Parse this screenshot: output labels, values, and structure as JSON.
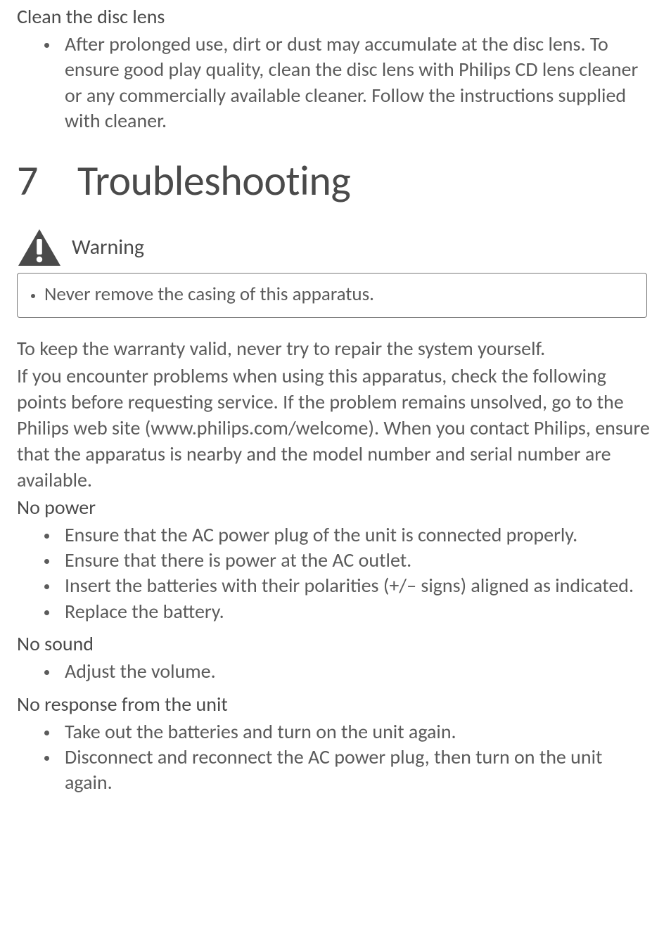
{
  "intro": {
    "heading": "Clean the disc lens",
    "bullets": [
      "After prolonged use, dirt or dust may accumulate at the disc lens. To ensure good play quality, clean the disc lens with Philips CD lens cleaner or any commercially available cleaner. Follow the instructions supplied with cleaner."
    ]
  },
  "chapter": {
    "number": "7",
    "title": "Troubleshooting"
  },
  "warning": {
    "label": "Warning",
    "items": [
      "Never remove the casing of this apparatus."
    ]
  },
  "body_paragraphs": [
    "To keep the warranty valid, never try to repair the system yourself.",
    "If you encounter problems when using this apparatus, check the following points before requesting service. If the problem remains unsolved, go to the Philips web site (www.philips.com/welcome). When you contact Philips, ensure that the apparatus is nearby and the model number and serial number are available."
  ],
  "sections": [
    {
      "heading": "No power",
      "bullets": [
        "Ensure that the AC power plug of the unit is connected properly.",
        "Ensure that there is power at the AC outlet.",
        "Insert the batteries with their polarities (+/– signs) aligned as indicated.",
        "Replace the battery."
      ]
    },
    {
      "heading": "No sound",
      "bullets": [
        "Adjust the volume."
      ]
    },
    {
      "heading": "No response from the unit",
      "bullets": [
        "Take out the batteries and turn on the unit again.",
        "Disconnect and reconnect the AC power plug, then turn on the unit again."
      ]
    }
  ]
}
